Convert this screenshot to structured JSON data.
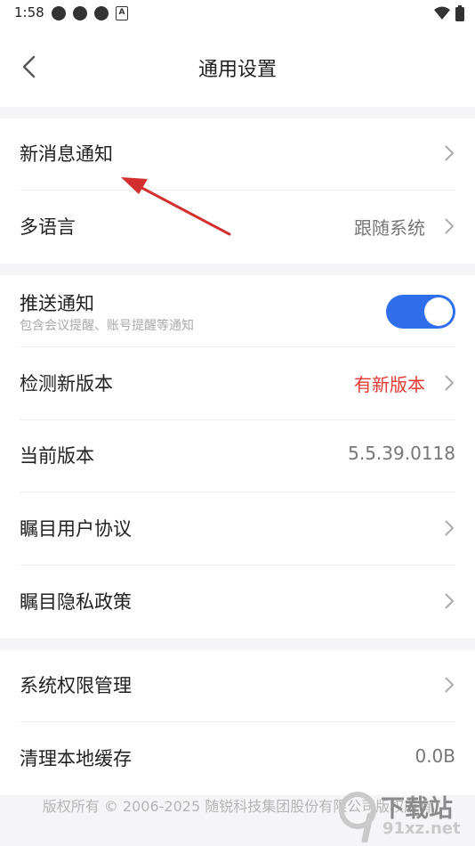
{
  "status_bar": {
    "time": "1:58"
  },
  "header": {
    "title": "通用设置"
  },
  "section1": {
    "items": [
      {
        "label": "新消息通知"
      },
      {
        "label": "多语言",
        "value": "跟随系统"
      }
    ]
  },
  "section2": {
    "items": [
      {
        "label": "推送通知",
        "sublabel": "包含会议提醒、账号提醒等通知",
        "toggle_on": true
      },
      {
        "label": "检测新版本",
        "value": "有新版本"
      },
      {
        "label": "当前版本",
        "value": "5.5.39.0118"
      },
      {
        "label": "瞩目用户协议"
      },
      {
        "label": "瞩目隐私政策"
      }
    ]
  },
  "section3": {
    "items": [
      {
        "label": "系统权限管理"
      },
      {
        "label": "清理本地缓存",
        "value": "0.0B"
      }
    ]
  },
  "footer": {
    "copyright": "版权所有 © 2006-2025 随锐科技集团股份有限公司版权所有"
  },
  "watermark": {
    "brand": "下载站",
    "site": "91xz.net"
  },
  "colors": {
    "accent": "#2f6fed",
    "alert": "#e53935",
    "annotation_arrow": "#d32f2f"
  }
}
